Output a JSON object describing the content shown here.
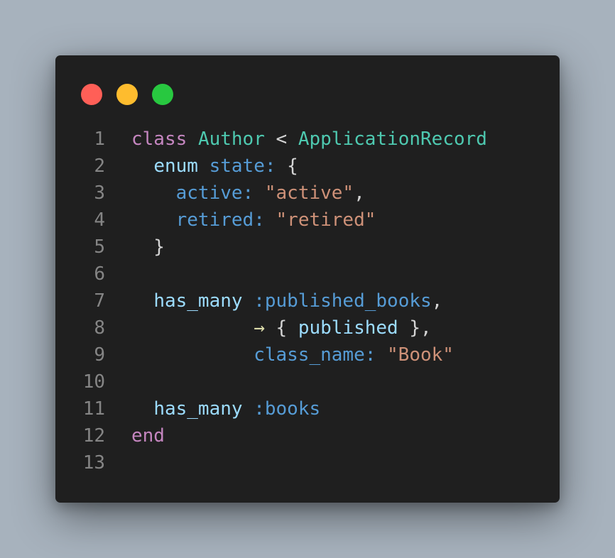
{
  "window": {
    "controls": {
      "close_color": "#ff5f57",
      "minimize_color": "#febc2e",
      "maximize_color": "#28c840"
    }
  },
  "code": {
    "language": "ruby",
    "lines": [
      {
        "number": "1",
        "tokens": [
          {
            "t": "class",
            "c": "kw"
          },
          {
            "t": " ",
            "c": "punc"
          },
          {
            "t": "Author",
            "c": "cls"
          },
          {
            "t": " < ",
            "c": "op"
          },
          {
            "t": "ApplicationRecord",
            "c": "cls"
          }
        ]
      },
      {
        "number": "2",
        "tokens": [
          {
            "t": "  ",
            "c": "punc"
          },
          {
            "t": "enum",
            "c": "fn"
          },
          {
            "t": " ",
            "c": "punc"
          },
          {
            "t": "state:",
            "c": "key"
          },
          {
            "t": " {",
            "c": "punc"
          }
        ]
      },
      {
        "number": "3",
        "tokens": [
          {
            "t": "    ",
            "c": "punc"
          },
          {
            "t": "active:",
            "c": "key"
          },
          {
            "t": " ",
            "c": "punc"
          },
          {
            "t": "\"active\"",
            "c": "str"
          },
          {
            "t": ",",
            "c": "punc"
          }
        ]
      },
      {
        "number": "4",
        "tokens": [
          {
            "t": "    ",
            "c": "punc"
          },
          {
            "t": "retired:",
            "c": "key"
          },
          {
            "t": " ",
            "c": "punc"
          },
          {
            "t": "\"retired\"",
            "c": "str"
          }
        ]
      },
      {
        "number": "5",
        "tokens": [
          {
            "t": "  }",
            "c": "punc"
          }
        ]
      },
      {
        "number": "6",
        "tokens": []
      },
      {
        "number": "7",
        "tokens": [
          {
            "t": "  ",
            "c": "punc"
          },
          {
            "t": "has_many",
            "c": "fn"
          },
          {
            "t": " ",
            "c": "punc"
          },
          {
            "t": ":published_books",
            "c": "key"
          },
          {
            "t": ",",
            "c": "punc"
          }
        ]
      },
      {
        "number": "8",
        "tokens": [
          {
            "t": "           ",
            "c": "punc"
          },
          {
            "t": "→",
            "c": "arrow"
          },
          {
            "t": " { ",
            "c": "punc"
          },
          {
            "t": "published",
            "c": "fn"
          },
          {
            "t": " },",
            "c": "punc"
          }
        ]
      },
      {
        "number": "9",
        "tokens": [
          {
            "t": "           ",
            "c": "punc"
          },
          {
            "t": "class_name:",
            "c": "key"
          },
          {
            "t": " ",
            "c": "punc"
          },
          {
            "t": "\"Book\"",
            "c": "str"
          }
        ]
      },
      {
        "number": "10",
        "tokens": []
      },
      {
        "number": "11",
        "tokens": [
          {
            "t": "  ",
            "c": "punc"
          },
          {
            "t": "has_many",
            "c": "fn"
          },
          {
            "t": " ",
            "c": "punc"
          },
          {
            "t": ":books",
            "c": "key"
          }
        ]
      },
      {
        "number": "12",
        "tokens": [
          {
            "t": "end",
            "c": "kw"
          }
        ]
      },
      {
        "number": "13",
        "tokens": []
      }
    ]
  }
}
